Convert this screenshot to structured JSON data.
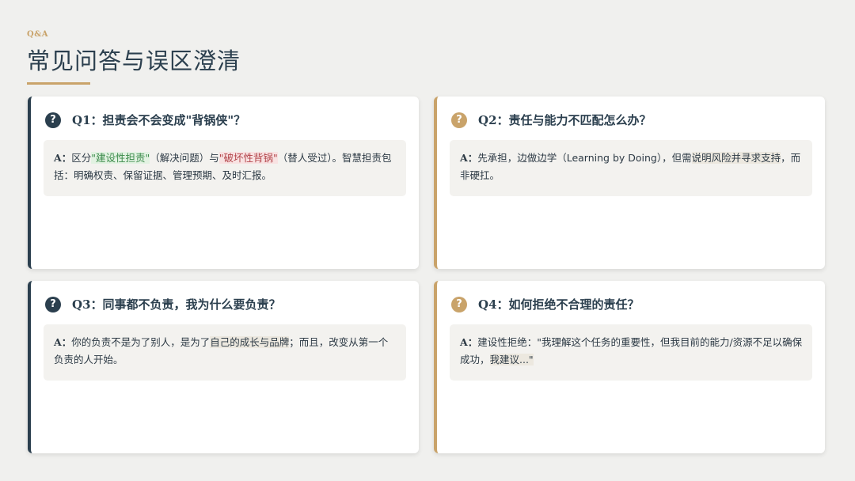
{
  "header": {
    "kicker": "Q&A",
    "title": "常见问答与误区澄清"
  },
  "cards": [
    {
      "icon": "?",
      "question": "Q1：担责会不会变成\"背锅侠\"？",
      "answer": {
        "label": "A：",
        "p1": "区分",
        "h1": "\"建设性担责\"",
        "p2": "（解决问题）与",
        "h2": "\"破坏性背锅\"",
        "p3": "（替人受过）。智慧担责包括：明确权责、保留证据、管理预期、及时汇报。"
      }
    },
    {
      "icon": "?",
      "question": "Q2：责任与能力不匹配怎么办？",
      "answer": {
        "label": "A：",
        "p1": "先承担，边做边学（Learning by Doing），但需",
        "h1": "说明风险并寻求支持",
        "p2": "，而非硬扛。"
      }
    },
    {
      "icon": "?",
      "question": "Q3：同事都不负责，我为什么要负责？",
      "answer": {
        "label": "A：",
        "p1": "你的负责不是为了别人，是为了",
        "h1": "自己的成长与品牌",
        "p2": "；而且，改变从第一个负责的人开始。"
      }
    },
    {
      "icon": "?",
      "question": "Q4：如何拒绝不合理的责任？",
      "answer": {
        "label": "A：",
        "p1": "建设性拒绝：\"我理解这个任务的重要性，但我目前的能力/资源不足以确保成功，",
        "h1": "我建议...\""
      }
    }
  ],
  "colors": {
    "navy": "#2b3f4e",
    "gold": "#c9a36a",
    "green_highlight": "#3b8a4a",
    "red_highlight": "#b2444a"
  }
}
